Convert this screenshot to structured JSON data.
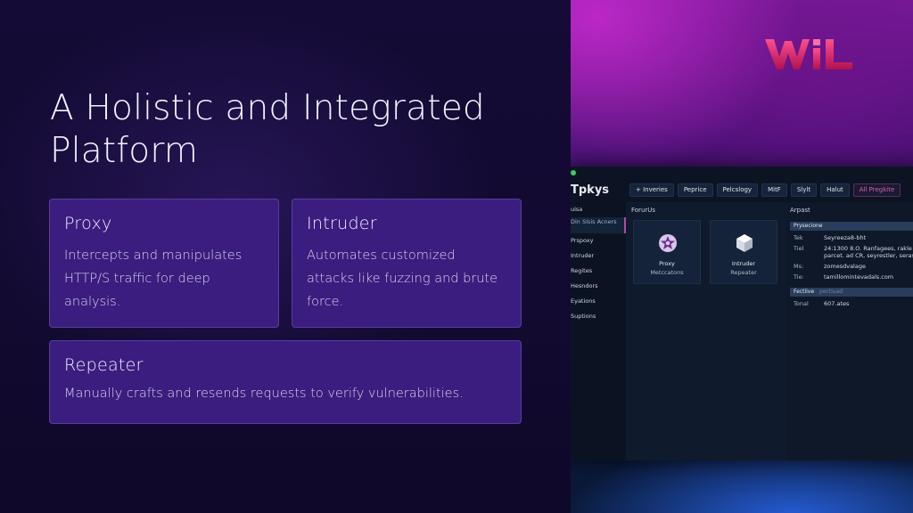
{
  "slide": {
    "title_line1": "A Holistic and Integrated",
    "title_line2": "Platform",
    "cards": [
      {
        "title": "Proxy",
        "description": "Intercepts and manipulates HTTP/S traffic for deep analysis."
      },
      {
        "title": "Intruder",
        "description": "Automates customized attacks like fuzzing and brute force."
      },
      {
        "title": "Repeater",
        "description": "Manually crafts and resends requests to verify vulnerabilities."
      }
    ]
  },
  "screenshot": {
    "logo_text": "WiL",
    "app": {
      "title": "Tpkys",
      "toolbar": [
        "+ Inveries",
        "Peprice",
        "Pelcslogy",
        "MitF",
        "Slylt",
        "Halut",
        "All Pregkite"
      ],
      "sidebar": [
        "uisa",
        "Din Slsis Acners",
        "Prspoxy",
        "Intruder",
        "Regites",
        "Hesndors",
        "Eyations",
        "Suptions"
      ],
      "main_label": "ForurUs",
      "tiles": [
        {
          "name": "Proxy",
          "sub": "Metccatons",
          "icon": "proxy-star-icon"
        },
        {
          "name": "Intruder",
          "sub": "Repeater",
          "icon": "intruder-cube-icon"
        }
      ],
      "detail": {
        "label": "Arpast",
        "section1": "Prysecione",
        "rows1": [
          {
            "k": "Tek",
            "v": "Seyreeza8-bht"
          },
          {
            "k": "Tiel",
            "v": "24:1300 8.O. Ranfagees, rakle",
            "v2": "parcet. ad CR, seyrestler, serase"
          },
          {
            "k": "Ms:",
            "v": "zomesdvalage"
          },
          {
            "k": "Tie:",
            "v": "tamillomintevadals.com"
          }
        ],
        "section2": "Fectiive",
        "section2_extra": "pectiuad",
        "rows2": [
          {
            "k": "Tonal",
            "v": "607.ates"
          }
        ]
      }
    }
  },
  "colors": {
    "background": "#110a2e",
    "card": "#3a1d7e",
    "accent_magenta": "#e05fb0",
    "logo": "#c2185b"
  }
}
